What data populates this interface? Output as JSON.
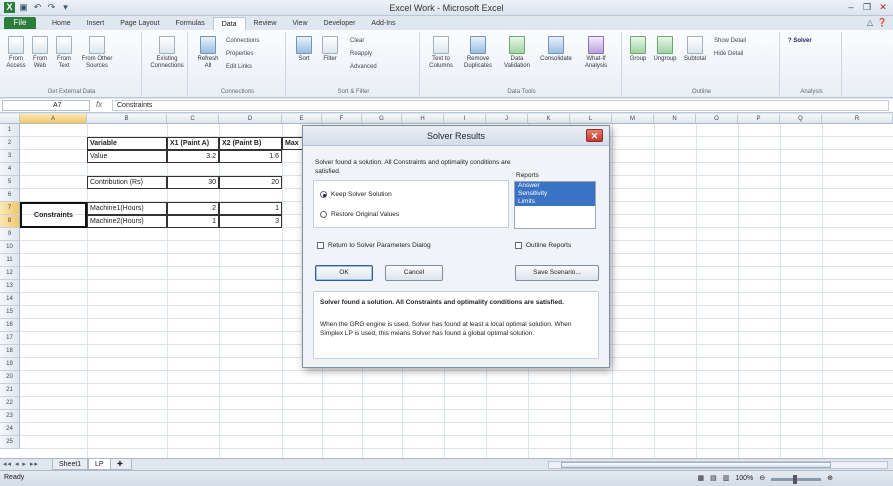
{
  "window": {
    "title": "Excel Work - Microsoft Excel"
  },
  "qat": [
    "save-icon",
    "undo-icon",
    "redo-icon",
    "filter-icon"
  ],
  "tabs": [
    "File",
    "Home",
    "Insert",
    "Page Layout",
    "Formulas",
    "Data",
    "Review",
    "View",
    "Developer",
    "Add-Ins"
  ],
  "active_tab": "Data",
  "ribbon": {
    "groups": [
      {
        "label": "Get External Data",
        "buttons": [
          "From Access",
          "From Web",
          "From Text",
          "From Other Sources"
        ]
      },
      {
        "label": "",
        "buttons": [
          "Existing Connections"
        ]
      },
      {
        "label": "Connections",
        "buttons": [
          "Refresh All"
        ],
        "small": [
          "Connections",
          "Properties",
          "Edit Links"
        ]
      },
      {
        "label": "Sort & Filter",
        "buttons": [
          "Sort",
          "Filter"
        ],
        "small": [
          "Clear",
          "Reapply",
          "Advanced"
        ]
      },
      {
        "label": "Data Tools",
        "buttons": [
          "Text to Columns",
          "Remove Duplicates",
          "Data Validation",
          "Consolidate",
          "What-If Analysis"
        ]
      },
      {
        "label": "Outline",
        "buttons": [
          "Group",
          "Ungroup",
          "Subtotal"
        ],
        "small": [
          "Show Detail",
          "Hide Detail"
        ]
      },
      {
        "label": "Analysis",
        "small": [
          "Solver"
        ]
      }
    ]
  },
  "formula_bar": {
    "name_box": "A7",
    "fx": "fx",
    "content": "Constraints"
  },
  "sheet": {
    "columns": [
      "A",
      "B",
      "C",
      "D",
      "E",
      "F",
      "G",
      "H",
      "I",
      "J",
      "K",
      "L",
      "M",
      "N",
      "O",
      "P",
      "Q",
      "R"
    ],
    "rows": [
      "1",
      "2",
      "3",
      "4",
      "5",
      "6",
      "7",
      "8",
      "9",
      "10",
      "11",
      "12",
      "13",
      "14",
      "15",
      "16",
      "17",
      "18",
      "19",
      "20",
      "21",
      "22",
      "23",
      "24",
      "25"
    ],
    "cells": {
      "variable": "Variable",
      "x1": "X1 (Paint A)",
      "x2": "X2 (Paint B)",
      "max": "Max",
      "value": "Value",
      "v1": "3.2",
      "v2": "1.6",
      "contribution": "Contribution (Rs)",
      "c1": "30",
      "c2": "20",
      "constraints": "Constraints",
      "m1": "Machine1(Hours)",
      "m1a": "2",
      "m1b": "1",
      "m2": "Machine2(Hours)",
      "m2a": "1",
      "m2b": "3"
    }
  },
  "dialog": {
    "title": "Solver Results",
    "message": "Solver found a solution.  All Constraints and optimality conditions are satisfied.",
    "reports_label": "Reports",
    "reports": [
      "Answer",
      "Sensitivity",
      "Limits"
    ],
    "keep": "Keep Solver Solution",
    "restore": "Restore Original Values",
    "return_to": "Return to Solver Parameters Dialog",
    "outline": "Outline Reports",
    "ok": "OK",
    "cancel": "Cancel",
    "save": "Save Scenario...",
    "desc_head": "Solver found a solution.  All Constraints and optimality conditions are satisfied.",
    "desc_body": "When the GRG engine is used, Solver has found at least a local optimal solution. When Simplex LP is used, this means Solver has found a global optimal solution."
  },
  "sheet_tabs": [
    "Sheet1",
    "LP"
  ],
  "active_sheet": "LP",
  "status": {
    "ready": "Ready",
    "zoom": "100%"
  }
}
